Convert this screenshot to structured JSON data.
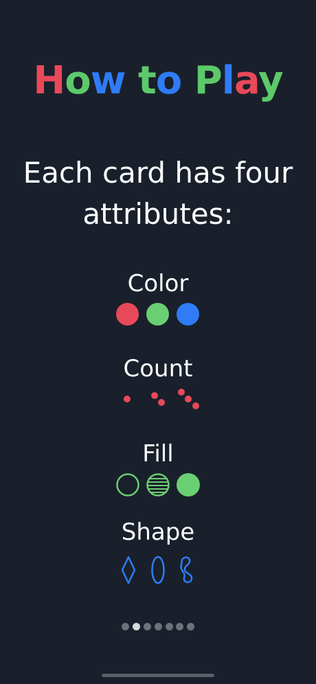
{
  "title": {
    "letters": [
      {
        "char": "H",
        "color": "#e8495a"
      },
      {
        "char": "o",
        "color": "#5dc96a"
      },
      {
        "char": "w",
        "color": "#2f7cf6"
      },
      {
        "char": " ",
        "color": "#ffffff"
      },
      {
        "char": "t",
        "color": "#5dc96a"
      },
      {
        "char": "o",
        "color": "#2f7cf6"
      },
      {
        "char": " ",
        "color": "#ffffff"
      },
      {
        "char": "P",
        "color": "#5dc96a"
      },
      {
        "char": "l",
        "color": "#2f7cf6"
      },
      {
        "char": "a",
        "color": "#e8495a"
      },
      {
        "char": "y",
        "color": "#5dc96a"
      }
    ]
  },
  "intro_text": "Each card has four attributes:",
  "attributes": {
    "color": {
      "label": "Color",
      "swatches": [
        "#e8495a",
        "#6acf72",
        "#2f7cf6"
      ]
    },
    "count": {
      "label": "Count",
      "dot_color": "#e8495a",
      "counts": [
        1,
        2,
        3
      ]
    },
    "fill": {
      "label": "Fill",
      "color": "#6acf72",
      "styles": [
        "empty",
        "striped",
        "solid"
      ]
    },
    "shape": {
      "label": "Shape",
      "color": "#2f7cf6",
      "shapes": [
        "diamond-icon",
        "oval-icon",
        "squiggle-icon"
      ]
    }
  },
  "pagination": {
    "total": 7,
    "current": 2
  },
  "colors": {
    "background": "#19202b",
    "text": "#ffffff"
  }
}
